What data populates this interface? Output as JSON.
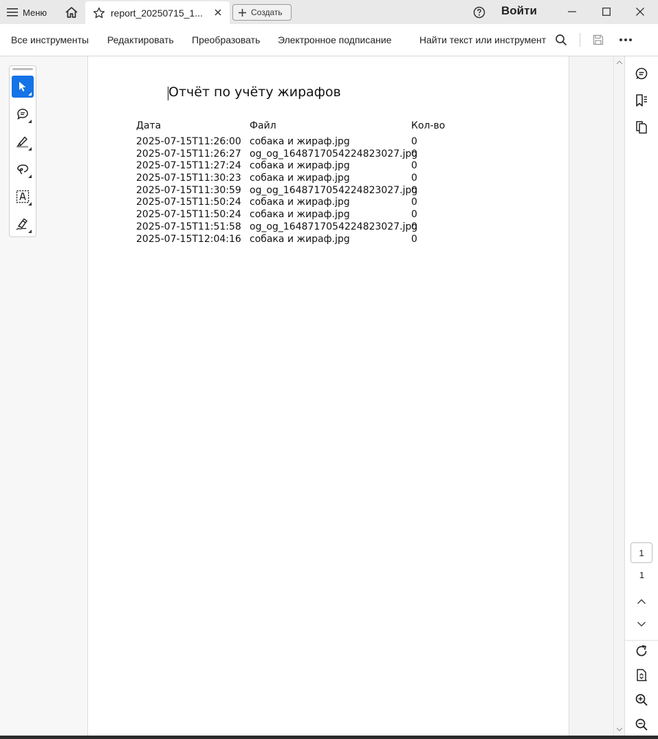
{
  "titlebar": {
    "menu_label": "Меню",
    "tab_title": "report_20250715_1...",
    "create_label": "Создать",
    "login_label": "Войти"
  },
  "toolbar": {
    "all_tools": "Все инструменты",
    "edit": "Редактировать",
    "convert": "Преобразовать",
    "esign": "Электронное подписание",
    "find": "Найти текст или инструмент"
  },
  "icons": {
    "menu": "hamburger-icon",
    "home": "home-icon",
    "favorite": "star-icon",
    "close_tab": "close-icon",
    "create": "plus-icon",
    "help": "help-icon",
    "minimize": "minimize-icon",
    "maximize": "maximize-icon",
    "close_window": "close-icon",
    "search": "search-icon",
    "save": "save-icon",
    "more": "more-icon"
  },
  "left_tools": [
    "select-tool",
    "comment-tool",
    "highlight-tool",
    "draw-tool",
    "text-select-tool",
    "sign-tool"
  ],
  "accent_color": "#1473e6",
  "document": {
    "title": "Отчёт по учёту жирафов",
    "columns": [
      "Дата",
      "Файл",
      "Кол-во"
    ],
    "rows": [
      [
        "2025-07-15T11:26:00",
        "собака и жираф.jpg",
        "0"
      ],
      [
        "2025-07-15T11:26:27",
        "og_og_1648717054224823027.jpg",
        "0"
      ],
      [
        "2025-07-15T11:27:24",
        "собака и жираф.jpg",
        "0"
      ],
      [
        "2025-07-15T11:30:23",
        "собака и жираф.jpg",
        "0"
      ],
      [
        "2025-07-15T11:30:59",
        "og_og_1648717054224823027.jpg",
        "0"
      ],
      [
        "2025-07-15T11:50:24",
        "собака и жираф.jpg",
        "0"
      ],
      [
        "2025-07-15T11:50:24",
        "собака и жираф.jpg",
        "0"
      ],
      [
        "2025-07-15T11:51:58",
        "og_og_1648717054224823027.jpg",
        "0"
      ],
      [
        "2025-07-15T12:04:16",
        "собака и жираф.jpg",
        "0"
      ]
    ]
  },
  "pagination": {
    "current_page": "1",
    "total_pages": "1"
  }
}
